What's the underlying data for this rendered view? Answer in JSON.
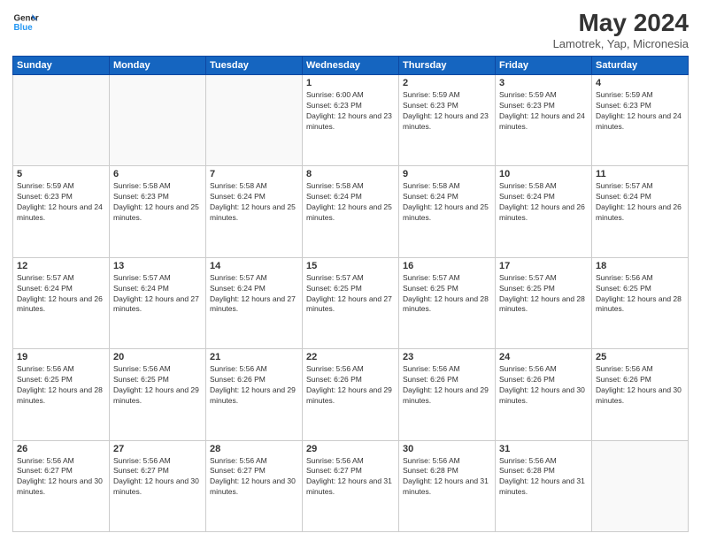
{
  "header": {
    "logo_line1": "General",
    "logo_line2": "Blue",
    "month": "May 2024",
    "location": "Lamotrek, Yap, Micronesia"
  },
  "days_of_week": [
    "Sunday",
    "Monday",
    "Tuesday",
    "Wednesday",
    "Thursday",
    "Friday",
    "Saturday"
  ],
  "weeks": [
    [
      {
        "day": "",
        "empty": true
      },
      {
        "day": "",
        "empty": true
      },
      {
        "day": "",
        "empty": true
      },
      {
        "day": "1",
        "sunrise": "Sunrise: 6:00 AM",
        "sunset": "Sunset: 6:23 PM",
        "daylight": "Daylight: 12 hours and 23 minutes."
      },
      {
        "day": "2",
        "sunrise": "Sunrise: 5:59 AM",
        "sunset": "Sunset: 6:23 PM",
        "daylight": "Daylight: 12 hours and 23 minutes."
      },
      {
        "day": "3",
        "sunrise": "Sunrise: 5:59 AM",
        "sunset": "Sunset: 6:23 PM",
        "daylight": "Daylight: 12 hours and 24 minutes."
      },
      {
        "day": "4",
        "sunrise": "Sunrise: 5:59 AM",
        "sunset": "Sunset: 6:23 PM",
        "daylight": "Daylight: 12 hours and 24 minutes."
      }
    ],
    [
      {
        "day": "5",
        "sunrise": "Sunrise: 5:59 AM",
        "sunset": "Sunset: 6:23 PM",
        "daylight": "Daylight: 12 hours and 24 minutes."
      },
      {
        "day": "6",
        "sunrise": "Sunrise: 5:58 AM",
        "sunset": "Sunset: 6:23 PM",
        "daylight": "Daylight: 12 hours and 25 minutes."
      },
      {
        "day": "7",
        "sunrise": "Sunrise: 5:58 AM",
        "sunset": "Sunset: 6:24 PM",
        "daylight": "Daylight: 12 hours and 25 minutes."
      },
      {
        "day": "8",
        "sunrise": "Sunrise: 5:58 AM",
        "sunset": "Sunset: 6:24 PM",
        "daylight": "Daylight: 12 hours and 25 minutes."
      },
      {
        "day": "9",
        "sunrise": "Sunrise: 5:58 AM",
        "sunset": "Sunset: 6:24 PM",
        "daylight": "Daylight: 12 hours and 25 minutes."
      },
      {
        "day": "10",
        "sunrise": "Sunrise: 5:58 AM",
        "sunset": "Sunset: 6:24 PM",
        "daylight": "Daylight: 12 hours and 26 minutes."
      },
      {
        "day": "11",
        "sunrise": "Sunrise: 5:57 AM",
        "sunset": "Sunset: 6:24 PM",
        "daylight": "Daylight: 12 hours and 26 minutes."
      }
    ],
    [
      {
        "day": "12",
        "sunrise": "Sunrise: 5:57 AM",
        "sunset": "Sunset: 6:24 PM",
        "daylight": "Daylight: 12 hours and 26 minutes."
      },
      {
        "day": "13",
        "sunrise": "Sunrise: 5:57 AM",
        "sunset": "Sunset: 6:24 PM",
        "daylight": "Daylight: 12 hours and 27 minutes."
      },
      {
        "day": "14",
        "sunrise": "Sunrise: 5:57 AM",
        "sunset": "Sunset: 6:24 PM",
        "daylight": "Daylight: 12 hours and 27 minutes."
      },
      {
        "day": "15",
        "sunrise": "Sunrise: 5:57 AM",
        "sunset": "Sunset: 6:25 PM",
        "daylight": "Daylight: 12 hours and 27 minutes."
      },
      {
        "day": "16",
        "sunrise": "Sunrise: 5:57 AM",
        "sunset": "Sunset: 6:25 PM",
        "daylight": "Daylight: 12 hours and 28 minutes."
      },
      {
        "day": "17",
        "sunrise": "Sunrise: 5:57 AM",
        "sunset": "Sunset: 6:25 PM",
        "daylight": "Daylight: 12 hours and 28 minutes."
      },
      {
        "day": "18",
        "sunrise": "Sunrise: 5:56 AM",
        "sunset": "Sunset: 6:25 PM",
        "daylight": "Daylight: 12 hours and 28 minutes."
      }
    ],
    [
      {
        "day": "19",
        "sunrise": "Sunrise: 5:56 AM",
        "sunset": "Sunset: 6:25 PM",
        "daylight": "Daylight: 12 hours and 28 minutes."
      },
      {
        "day": "20",
        "sunrise": "Sunrise: 5:56 AM",
        "sunset": "Sunset: 6:25 PM",
        "daylight": "Daylight: 12 hours and 29 minutes."
      },
      {
        "day": "21",
        "sunrise": "Sunrise: 5:56 AM",
        "sunset": "Sunset: 6:26 PM",
        "daylight": "Daylight: 12 hours and 29 minutes."
      },
      {
        "day": "22",
        "sunrise": "Sunrise: 5:56 AM",
        "sunset": "Sunset: 6:26 PM",
        "daylight": "Daylight: 12 hours and 29 minutes."
      },
      {
        "day": "23",
        "sunrise": "Sunrise: 5:56 AM",
        "sunset": "Sunset: 6:26 PM",
        "daylight": "Daylight: 12 hours and 29 minutes."
      },
      {
        "day": "24",
        "sunrise": "Sunrise: 5:56 AM",
        "sunset": "Sunset: 6:26 PM",
        "daylight": "Daylight: 12 hours and 30 minutes."
      },
      {
        "day": "25",
        "sunrise": "Sunrise: 5:56 AM",
        "sunset": "Sunset: 6:26 PM",
        "daylight": "Daylight: 12 hours and 30 minutes."
      }
    ],
    [
      {
        "day": "26",
        "sunrise": "Sunrise: 5:56 AM",
        "sunset": "Sunset: 6:27 PM",
        "daylight": "Daylight: 12 hours and 30 minutes."
      },
      {
        "day": "27",
        "sunrise": "Sunrise: 5:56 AM",
        "sunset": "Sunset: 6:27 PM",
        "daylight": "Daylight: 12 hours and 30 minutes."
      },
      {
        "day": "28",
        "sunrise": "Sunrise: 5:56 AM",
        "sunset": "Sunset: 6:27 PM",
        "daylight": "Daylight: 12 hours and 30 minutes."
      },
      {
        "day": "29",
        "sunrise": "Sunrise: 5:56 AM",
        "sunset": "Sunset: 6:27 PM",
        "daylight": "Daylight: 12 hours and 31 minutes."
      },
      {
        "day": "30",
        "sunrise": "Sunrise: 5:56 AM",
        "sunset": "Sunset: 6:28 PM",
        "daylight": "Daylight: 12 hours and 31 minutes."
      },
      {
        "day": "31",
        "sunrise": "Sunrise: 5:56 AM",
        "sunset": "Sunset: 6:28 PM",
        "daylight": "Daylight: 12 hours and 31 minutes."
      },
      {
        "day": "",
        "empty": true
      }
    ]
  ]
}
